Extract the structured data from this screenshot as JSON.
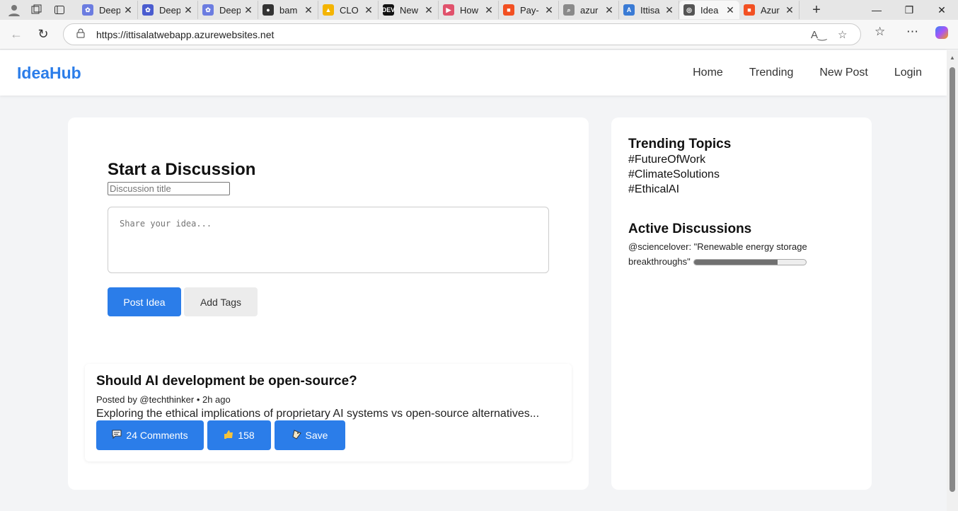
{
  "browser": {
    "tabs": [
      {
        "label": "Deep",
        "fav_color": "#6b7ce0",
        "fav_glyph": "✿"
      },
      {
        "label": "Deep",
        "fav_color": "#4a5ccf",
        "fav_glyph": "✿"
      },
      {
        "label": "Deep",
        "fav_color": "#6b7ce0",
        "fav_glyph": "✿"
      },
      {
        "label": "bam",
        "fav_color": "#333333",
        "fav_glyph": "●"
      },
      {
        "label": "CLO",
        "fav_color": "#f4b400",
        "fav_glyph": "▲"
      },
      {
        "label": "New",
        "fav_color": "#111111",
        "fav_glyph": "DEV"
      },
      {
        "label": "How",
        "fav_color": "#e0526c",
        "fav_glyph": "▶"
      },
      {
        "label": "Pay-",
        "fav_color": "#f25022",
        "fav_glyph": "■"
      },
      {
        "label": "azur",
        "fav_color": "#8a8a8a",
        "fav_glyph": "⌕"
      },
      {
        "label": "Ittisa",
        "fav_color": "#3a7bd5",
        "fav_glyph": "A"
      },
      {
        "label": "Idea",
        "fav_color": "#555555",
        "fav_glyph": "◎",
        "active": true
      },
      {
        "label": "Azur",
        "fav_color": "#f25022",
        "fav_glyph": "■"
      }
    ],
    "url": "https://ittisalatwebapp.azurewebsites.net"
  },
  "app": {
    "brand": "IdeaHub",
    "nav": [
      "Home",
      "Trending",
      "New Post",
      "Login"
    ]
  },
  "compose": {
    "heading": "Start a Discussion",
    "title_placeholder": "Discussion title",
    "idea_placeholder": "Share your idea...",
    "post_button": "Post Idea",
    "tags_button": "Add Tags"
  },
  "post": {
    "title": "Should AI development be open-source?",
    "meta": "Posted by @techthinker • 2h ago",
    "excerpt": "Exploring the ethical implications of proprietary AI systems vs open-source alternatives...",
    "comments": "24 Comments",
    "likes": "158",
    "save": "Save"
  },
  "sidebar": {
    "trending_heading": "Trending Topics",
    "topics": [
      "#FutureOfWork",
      "#ClimateSolutions",
      "#EthicalAI"
    ],
    "active_heading": "Active Discussions",
    "active_item": "@sciencelover: \"Renewable energy storage breakthroughs\"",
    "active_progress": 0.75
  },
  "colors": {
    "accent": "#2b7de9",
    "page_bg": "#f3f4f6"
  }
}
